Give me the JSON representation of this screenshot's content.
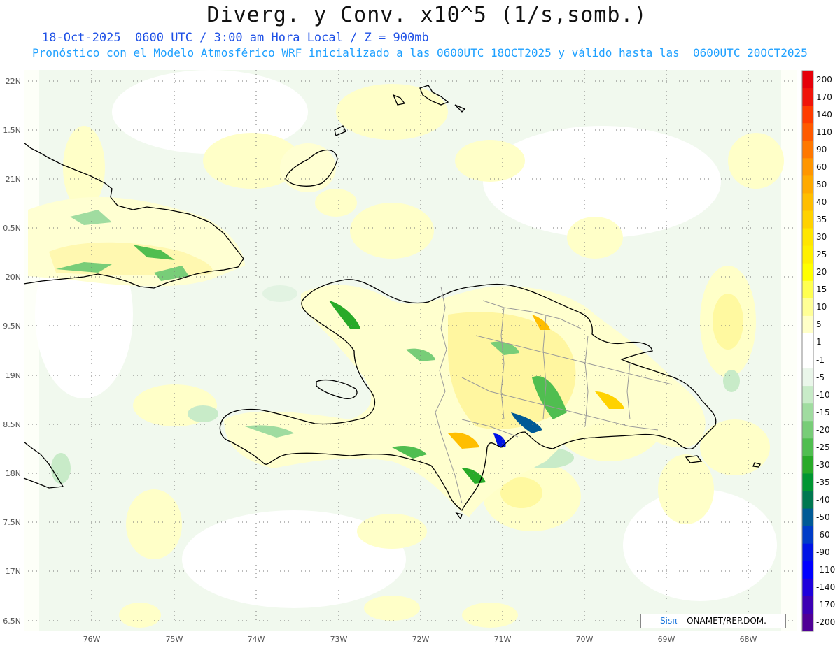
{
  "title": "Diverg. y Conv. x10^5 (1/s,somb.)",
  "subtitle": "18-Oct-2025  0600 UTC / 3:00 am Hora Local / Z = 900mb",
  "subtitle2": "Pronóstico con el Modelo Atmosférico WRF inicializado a las 0600UTC_18OCT2025 y válido hasta las  0600UTC_20OCT2025",
  "credit": {
    "brand": "Sisπ",
    "rest": " – ONAMET/REP.DOM."
  },
  "map": {
    "lat_labels": [
      "22N",
      "1.5N",
      "21N",
      "0.5N",
      "20N",
      "9.5N",
      "19N",
      "8.5N",
      "18N",
      "7.5N",
      "17N",
      "6.5N"
    ],
    "lon_labels": [
      "76W",
      "75W",
      "74W",
      "73W",
      "72W",
      "71W",
      "70W",
      "69W",
      "68W"
    ],
    "lat_range": [
      16.5,
      22.0
    ],
    "lon_range": [
      -76.8,
      -67.5
    ],
    "region": "Hispaniola, eastern Cuba, Great Inagua"
  },
  "colorbar": {
    "labels": [
      "200",
      "170",
      "140",
      "110",
      "90",
      "60",
      "50",
      "40",
      "35",
      "30",
      "25",
      "20",
      "15",
      "10",
      "5",
      "1",
      "-1",
      "-5",
      "-10",
      "-15",
      "-20",
      "-25",
      "-30",
      "-35",
      "-40",
      "-50",
      "-60",
      "-90",
      "-110",
      "-140",
      "-170",
      "-200"
    ],
    "colors": [
      "#e6000a",
      "#f0140a",
      "#ff3c00",
      "#ff5a00",
      "#ff7800",
      "#ff9600",
      "#ffaa00",
      "#ffbe00",
      "#ffd200",
      "#ffe600",
      "#fff000",
      "#ffff00",
      "#ffff50",
      "#ffff96",
      "#ffffc8",
      "#ffffff",
      "#ffffff",
      "#eaf6ea",
      "#c8ebc8",
      "#a0dca0",
      "#78cd78",
      "#50be50",
      "#28aa28",
      "#009632",
      "#007850",
      "#005a96",
      "#003cc8",
      "#0014e6",
      "#0000ff",
      "#1e00dc",
      "#3c00b4",
      "#500096"
    ]
  }
}
